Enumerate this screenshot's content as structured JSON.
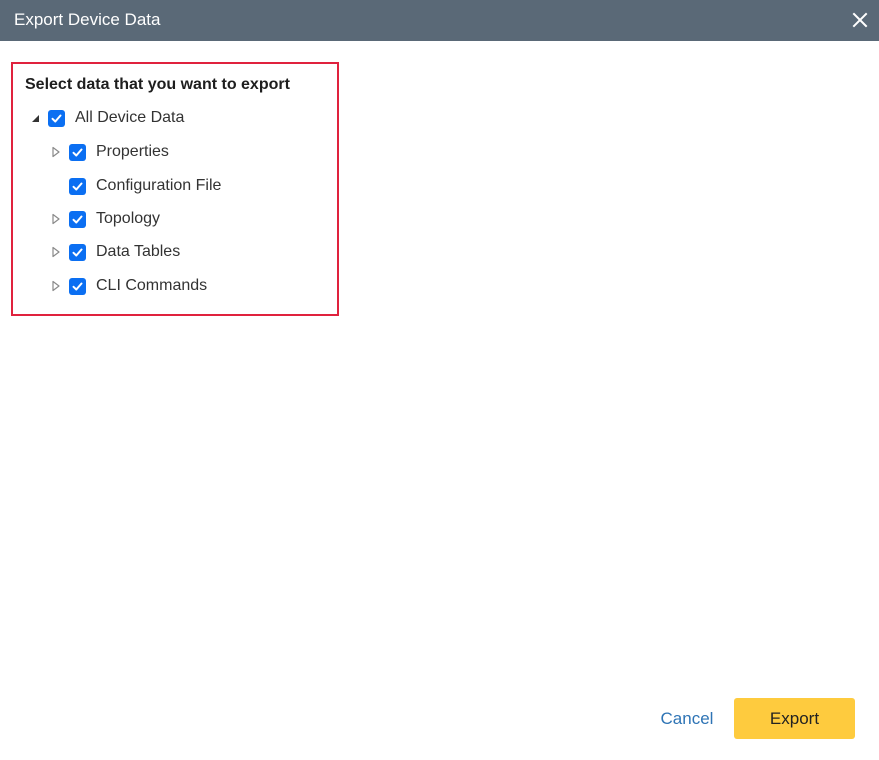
{
  "dialog": {
    "title": "Export Device Data",
    "close_icon": "close-icon",
    "colors": {
      "titlebar": "#5a6977",
      "highlight_border": "#e0223e",
      "checkbox": "#0b6ff2",
      "primary_button": "#fecb3e",
      "link": "#2e74b5"
    }
  },
  "selection": {
    "heading": "Select data that you want to export",
    "tree": [
      {
        "label": "All Device Data",
        "checked": true,
        "expander": "expanded",
        "level": 0
      },
      {
        "label": "Properties",
        "checked": true,
        "expander": "collapsed",
        "level": 1
      },
      {
        "label": "Configuration File",
        "checked": true,
        "expander": "none",
        "level": 1
      },
      {
        "label": "Topology",
        "checked": true,
        "expander": "collapsed",
        "level": 1
      },
      {
        "label": "Data Tables",
        "checked": true,
        "expander": "collapsed",
        "level": 1
      },
      {
        "label": "CLI Commands",
        "checked": true,
        "expander": "collapsed",
        "level": 1
      }
    ]
  },
  "footer": {
    "cancel_label": "Cancel",
    "export_label": "Export"
  }
}
